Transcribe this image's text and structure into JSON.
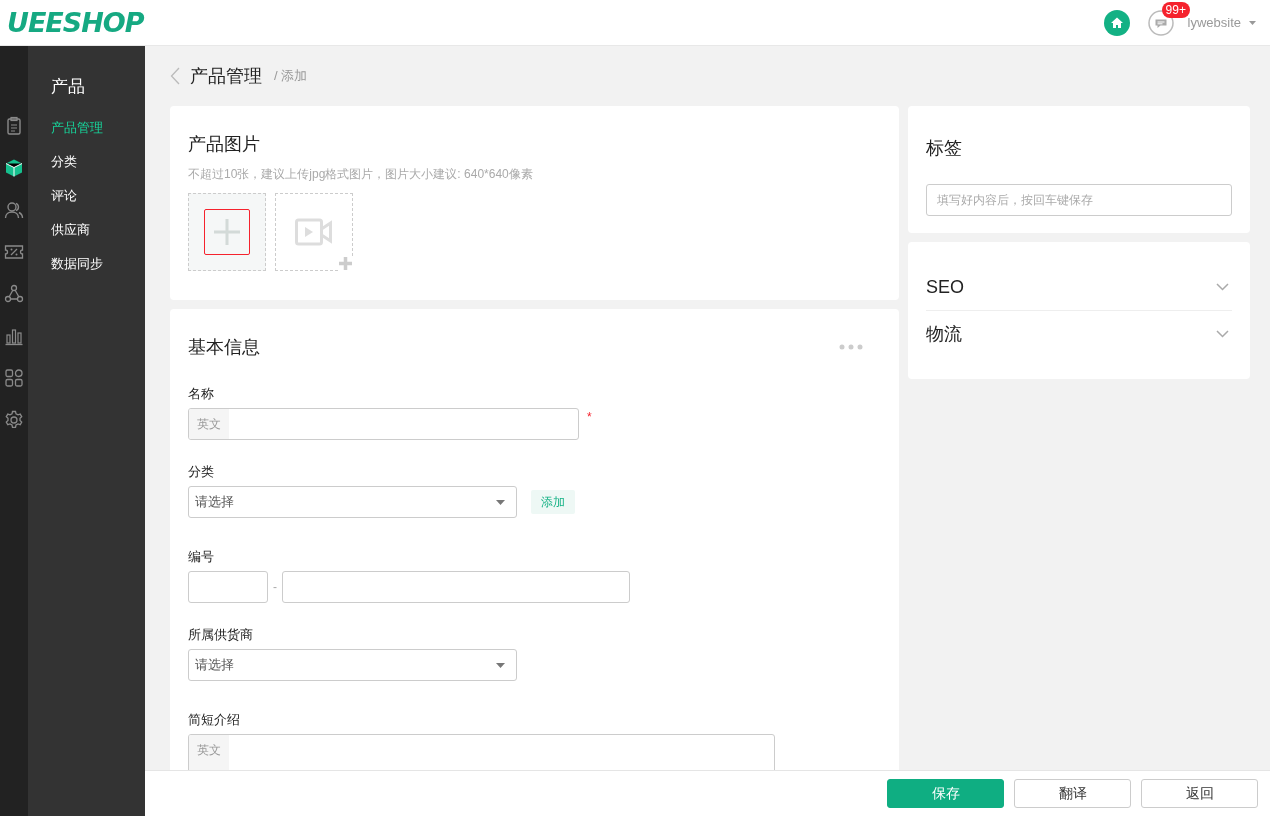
{
  "header": {
    "logo": "UEESHOP",
    "notification_badge": "99+",
    "user": "lywebsite"
  },
  "rail": [
    {
      "kind": "clipboard",
      "selected": false
    },
    {
      "kind": "cube",
      "selected": true
    },
    {
      "kind": "users",
      "selected": false
    },
    {
      "kind": "coupon",
      "selected": false
    },
    {
      "kind": "network",
      "selected": false
    },
    {
      "kind": "chart",
      "selected": false
    },
    {
      "kind": "apps",
      "selected": false
    },
    {
      "kind": "settings",
      "selected": false
    }
  ],
  "sidebar": {
    "title": "产品",
    "items": [
      {
        "label": "产品管理",
        "selected": true
      },
      {
        "label": "分类",
        "selected": false
      },
      {
        "label": "评论",
        "selected": false
      },
      {
        "label": "供应商",
        "selected": false
      },
      {
        "label": "数据同步",
        "selected": false
      }
    ]
  },
  "breadcrumb": {
    "title": "产品管理",
    "current": "/ 添加"
  },
  "images_card": {
    "title": "产品图片",
    "hint": "不超过10张，建议上传jpg格式图片，图片大小建议: 640*640像素"
  },
  "basic_info": {
    "title": "基本信息",
    "fields": [
      {
        "kind": "text",
        "label": "名称",
        "prefix": "英文",
        "required_mark": "*"
      },
      {
        "kind": "select",
        "label": "分类",
        "value": "请选择",
        "action": "添加"
      },
      {
        "kind": "code",
        "label": "编号",
        "separator": "-"
      },
      {
        "kind": "select",
        "label": "所属供货商",
        "value": "请选择"
      },
      {
        "kind": "textarea",
        "label": "简短介绍",
        "prefix": "英文"
      }
    ]
  },
  "tags": {
    "title": "标签",
    "placeholder": "填写好内容后，按回车键保存"
  },
  "sections": [
    {
      "title": "SEO",
      "expanded": false
    },
    {
      "title": "物流",
      "expanded": false
    }
  ],
  "actions": [
    {
      "label": "保存",
      "kind": "primary"
    },
    {
      "label": "翻译",
      "kind": "default"
    },
    {
      "label": "返回",
      "kind": "default"
    }
  ]
}
